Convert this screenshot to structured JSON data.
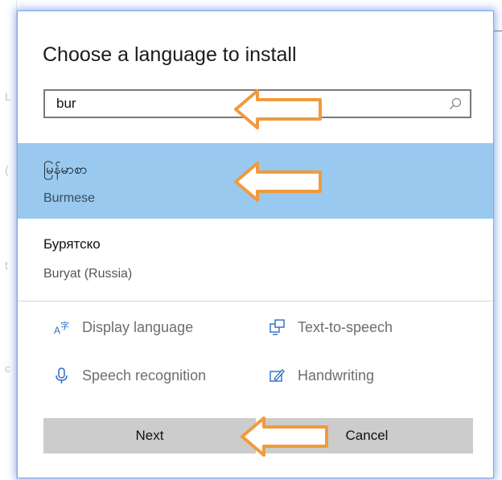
{
  "dialog": {
    "title": "Choose a language to install"
  },
  "search": {
    "value": "bur",
    "icon": "search-icon"
  },
  "languages": [
    {
      "native": "မြန်မာစာ",
      "english": "Burmese",
      "selected": true
    },
    {
      "native": "Бурятско",
      "english": "Buryat (Russia)",
      "selected": false
    }
  ],
  "features": [
    {
      "label": "Display language",
      "icon": "display-language-icon"
    },
    {
      "label": "Text-to-speech",
      "icon": "text-to-speech-icon"
    },
    {
      "label": "Speech recognition",
      "icon": "microphone-icon"
    },
    {
      "label": "Handwriting",
      "icon": "handwriting-icon"
    }
  ],
  "buttons": {
    "next": "Next",
    "cancel": "Cancel"
  },
  "colors": {
    "selected_row": "#99c9ef",
    "button_bg": "#cccccc",
    "arrow_stroke": "#f09a3e",
    "accent_feature_icon": "#2b6cc4"
  }
}
